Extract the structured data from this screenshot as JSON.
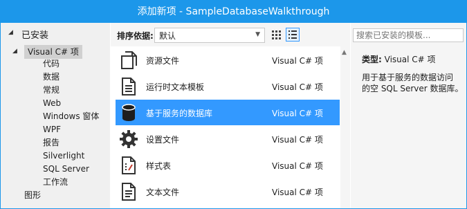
{
  "title": "添加新项 - SampleDatabaseWalkthrough",
  "left": {
    "installed_label": "已安装",
    "category": "Visual C# 项",
    "subitems": [
      "代码",
      "数据",
      "常规",
      "Web",
      "Windows 窗体",
      "WPF",
      "报告",
      "Silverlight",
      "SQL Server",
      "工作流"
    ],
    "next_category": "图形"
  },
  "toolbar": {
    "sort_label": "排序依据:",
    "sort_value": "默认"
  },
  "items": [
    {
      "name": "资源文件",
      "type": "Visual C# 项",
      "icon": "resource-file-icon"
    },
    {
      "name": "运行时文本模板",
      "type": "Visual C# 项",
      "icon": "text-template-icon"
    },
    {
      "name": "基于服务的数据库",
      "type": "Visual C# 项",
      "icon": "database-icon"
    },
    {
      "name": "设置文件",
      "type": "Visual C# 项",
      "icon": "settings-gear-icon"
    },
    {
      "name": "样式表",
      "type": "Visual C# 项",
      "icon": "stylesheet-icon"
    },
    {
      "name": "文本文件",
      "type": "Visual C# 项",
      "icon": "text-file-icon"
    }
  ],
  "search": {
    "placeholder": "搜索已安装的模板..."
  },
  "info": {
    "type_label": "类型:",
    "type_value": "Visual C# 项",
    "description_line1": "用于基于服务的数据访问",
    "description_line2": "的空 SQL Server 数据库。"
  },
  "colors": {
    "title_bar": "#1c97ea",
    "selection": "#3399ff"
  }
}
